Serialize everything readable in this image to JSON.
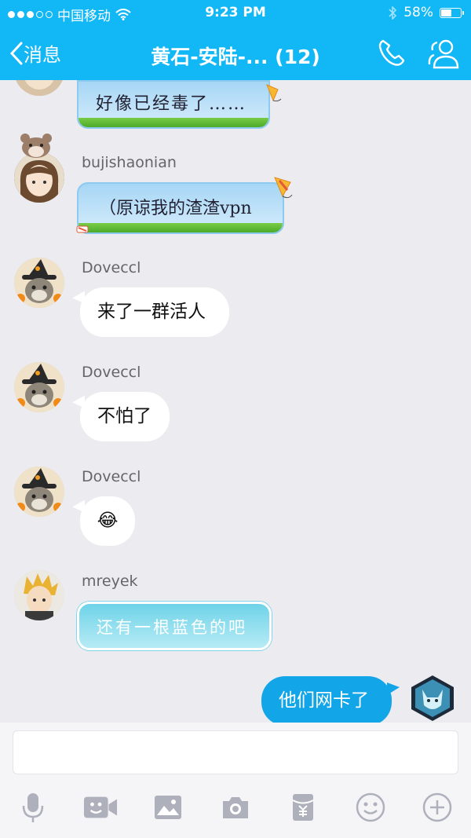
{
  "status_bar": {
    "carrier": "中国移动",
    "time": "9:23 PM",
    "battery": "58%",
    "battery_level": 0.58
  },
  "nav": {
    "back_label": "消息",
    "title": "黄石-安陆-... (12)"
  },
  "colors": {
    "header": "#12b7f5",
    "my_bubble": "#12a5e8",
    "background": "#ebebf0"
  },
  "messages": [
    {
      "sender": "",
      "text": "好像已经毒了……"
    },
    {
      "sender": "bujishaonian",
      "text": "（原谅我的渣渣vpn"
    },
    {
      "sender": "Doveccl",
      "text": "来了一群活人"
    },
    {
      "sender": "Doveccl",
      "text": "不怕了"
    },
    {
      "sender": "Doveccl",
      "text": "😂"
    },
    {
      "sender": "mreyek",
      "text": "还有一根蓝色的吧"
    },
    {
      "sender": "me",
      "text": "他们网卡了"
    }
  ],
  "toolbar": {
    "icons": [
      "microphone-icon",
      "video-icon",
      "image-icon",
      "camera-icon",
      "red-packet-icon",
      "emoji-icon",
      "plus-icon"
    ]
  }
}
